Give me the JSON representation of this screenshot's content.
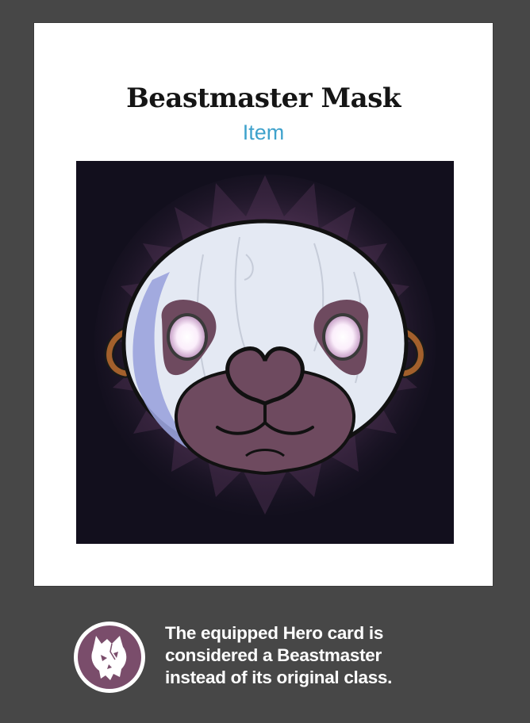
{
  "card": {
    "title": "Beastmaster Mask",
    "type": "Item",
    "type_color": "#3fa2cc"
  },
  "artwork": {
    "subject": "beast-mask-illustration",
    "background_color": "#120f1d",
    "glow_color": "#8a5a8a"
  },
  "footer": {
    "class_icon": "beastmaster-class-icon",
    "class_icon_color": "#7a4d6b",
    "ability_lines": [
      "The equipped Hero card is",
      "considered a Beastmaster",
      "instead of its original class."
    ]
  }
}
